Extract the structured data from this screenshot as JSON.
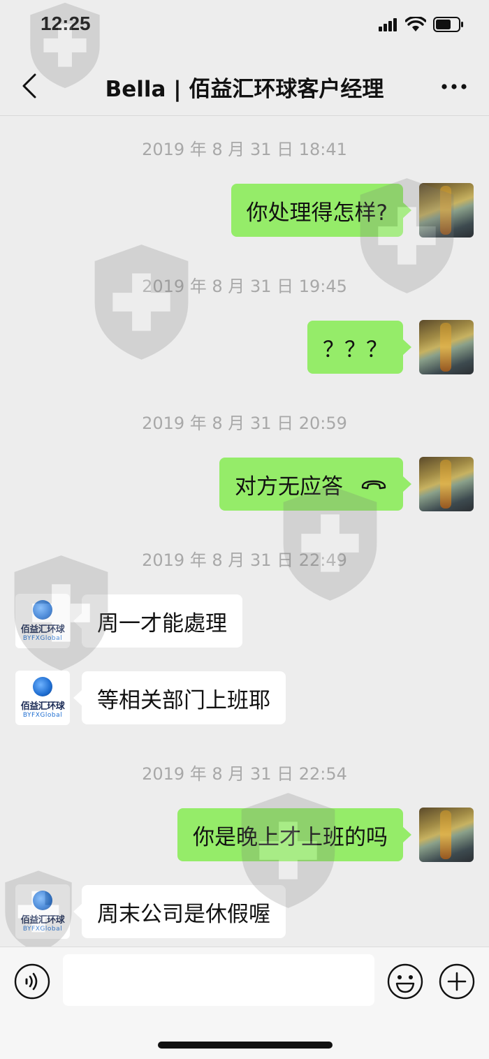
{
  "status_bar": {
    "time": "12:25",
    "icons": [
      "signal-icon",
      "wifi-icon",
      "battery-icon"
    ]
  },
  "nav": {
    "back_icon": "chevron-left-icon",
    "title": "Bella | 佰益汇环球客户经理",
    "more_icon": "more-dots-icon"
  },
  "messages": {
    "ts1": "2019 年 8 月 31 日 18:41",
    "m1": "你处理得怎样?",
    "ts2": "2019 年 8 月 31 日 19:45",
    "m2": "？？？",
    "ts3": "2019 年 8 月 31 日 20:59",
    "m3": "对方无应答",
    "ts4": "2019 年 8 月 31 日 22:49",
    "m4": "周一才能處理",
    "m5": "等相关部门上班耶",
    "ts5": "2019 年 8 月 31 日 22:54",
    "m6": "你是晚上才上班的吗",
    "m7": "周末公司是休假喔"
  },
  "contact_avatar": {
    "logo_cn": "佰益汇环球",
    "logo_en": "BYFXGlobal"
  },
  "input_bar": {
    "voice_icon": "voice-icon",
    "emoji_icon": "emoji-icon",
    "plus_icon": "plus-icon"
  },
  "colors": {
    "background": "#ededed",
    "sent_bubble": "#95ec69",
    "received_bubble": "#ffffff",
    "timestamp": "#a8a8a8"
  }
}
